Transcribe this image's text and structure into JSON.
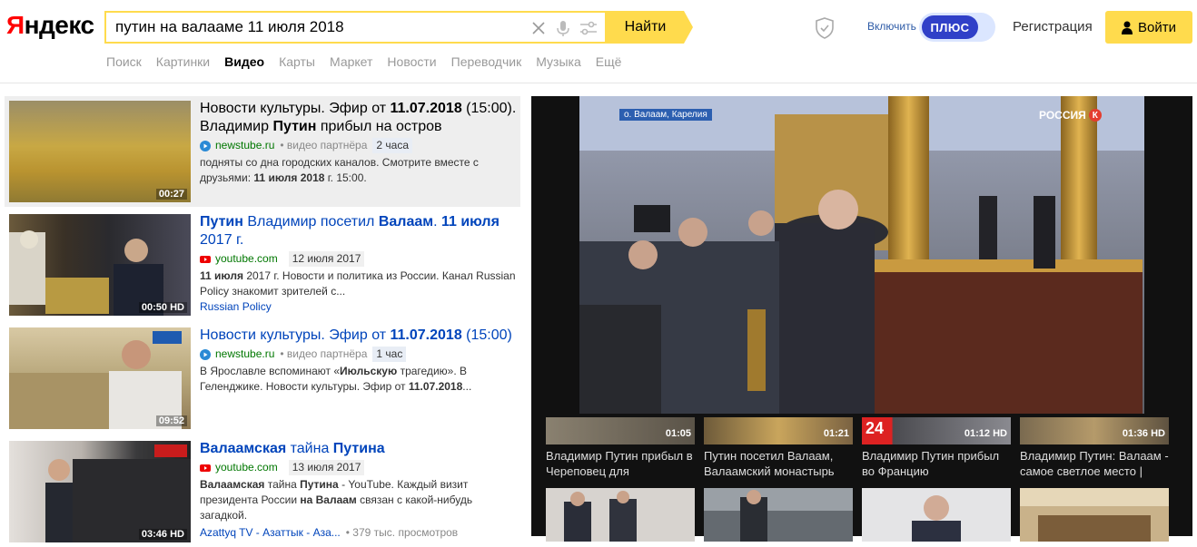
{
  "header": {
    "logo_ya": "Я",
    "logo_rest": "ндекс",
    "search_value": "путин на валааме 11 июля 2018",
    "find_label": "Найти",
    "plus_enable": "Включить",
    "plus_label": "ПЛЮС",
    "register_label": "Регистрация",
    "login_label": "Войти"
  },
  "nav": [
    "Поиск",
    "Картинки",
    "Видео",
    "Карты",
    "Маркет",
    "Новости",
    "Переводчик",
    "Музыка",
    "Ещё"
  ],
  "results": [
    {
      "title_parts": [
        "Новости культуры. Эфир от ",
        "11.07.2018",
        " (15:00). Владимир ",
        "Путин",
        " прибыл на остров"
      ],
      "host": "newstube.ru",
      "partner": "• видео партнёра",
      "age": "2 часа",
      "desc_parts": [
        "подняты со дна городских каналов. Смотрите вместе с друзьями: ",
        "11 июля 2018",
        " г. 15:00."
      ],
      "duration": "00:27",
      "hd": ""
    },
    {
      "title_parts": [
        "Путин",
        " Владимир посетил ",
        "Валаам",
        ". ",
        "11 июля",
        " 2017 г."
      ],
      "host": "youtube.com",
      "date": "12 июля 2017",
      "desc_parts": [
        "11 июля",
        " 2017 г. Новости и политика из России. Канал Russian Policy знакомит зрителей с..."
      ],
      "channel": "Russian Policy",
      "duration": "00:50",
      "hd": "HD"
    },
    {
      "title_parts": [
        "Новости культуры. Эфир от ",
        "11.07.2018",
        " (15:00)"
      ],
      "host": "newstube.ru",
      "partner": "• видео партнёра",
      "age": "1 час",
      "desc_parts": [
        "В Ярославле вспоминают «",
        "Июльскую",
        " трагедию». В Геленджике. Новости культуры. Эфир от ",
        "11.07.2018",
        "..."
      ],
      "duration": "09:52",
      "hd": ""
    },
    {
      "title_parts": [
        "Валаамская",
        " тайна ",
        "Путина"
      ],
      "host": "youtube.com",
      "date": "13 июля 2017",
      "desc_parts": [
        "Валаамская",
        " тайна ",
        "Путина",
        " - YouTube. Каждый визит президента России ",
        "на Валаам",
        " связан с какой-нибудь загадкой."
      ],
      "channel": "Azattyq TV - Азаттык - Аза...",
      "views": "• 379 тыс. просмотров",
      "duration": "03:46",
      "hd": "HD"
    }
  ],
  "player": {
    "location_caption": "о. Валаам, Карелия",
    "channel_logo": "РОССИЯ",
    "channel_logo_k": "К"
  },
  "related": [
    {
      "title": "Владимир Путин прибыл в Череповец для",
      "duration": "01:05",
      "hd": ""
    },
    {
      "title": "Путин посетил Валаам, Валаамский монастырь",
      "duration": "01:21",
      "hd": ""
    },
    {
      "title": "Владимир Путин прибыл во Францию",
      "duration": "01:12",
      "hd": "HD",
      "badge": "24"
    },
    {
      "title": "Владимир Путин: Валаам - самое светлое место |",
      "duration": "01:36",
      "hd": "HD"
    }
  ]
}
